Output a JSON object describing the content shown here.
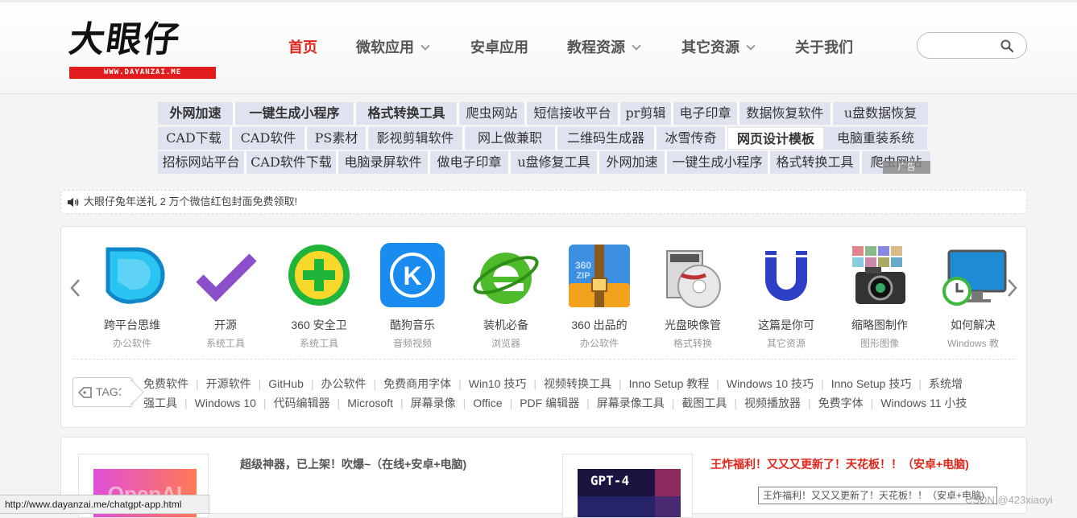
{
  "header": {
    "logo_text": "大眼仔",
    "logo_sub": "WWW.DAYANZAI.ME",
    "nav": [
      {
        "label": "首页",
        "active": true,
        "dropdown": false
      },
      {
        "label": "微软应用",
        "active": false,
        "dropdown": true
      },
      {
        "label": "安卓应用",
        "active": false,
        "dropdown": false
      },
      {
        "label": "教程资源",
        "active": false,
        "dropdown": true
      },
      {
        "label": "其它资源",
        "active": false,
        "dropdown": true
      },
      {
        "label": "关于我们",
        "active": false,
        "dropdown": false
      }
    ],
    "search": {
      "placeholder": "",
      "value": "",
      "icon": "search-icon"
    }
  },
  "keywords": {
    "rows": [
      [
        "外网加速",
        "一键生成小程序",
        "格式转换工具",
        "爬虫网站",
        "短信接收平台",
        "pr剪辑",
        "电子印章",
        "数据恢复软件",
        "u盘数据恢复"
      ],
      [
        "CAD下载",
        "CAD软件",
        "PS素材",
        "影视剪辑软件",
        "网上做兼职",
        "二维码生成器",
        "冰雪传奇",
        "网页设计模板",
        "电脑重装系统"
      ],
      [
        "招标网站平台",
        "CAD软件下载",
        "电脑录屏软件",
        "做电子印章",
        "u盘修复工具",
        "外网加速",
        "一键生成小程序",
        "格式转换工具",
        "爬虫网站"
      ]
    ],
    "ad_label": "广告"
  },
  "notice": {
    "icon": "speaker-icon",
    "text": "大眼仔兔年送礼 2 万个微信红包封面免费领取!"
  },
  "apps": [
    {
      "name": "跨平台思维",
      "category": "办公软件",
      "icon": "xmind-icon"
    },
    {
      "name": "开源",
      "category": "系统工具",
      "icon": "checkmark-icon"
    },
    {
      "name": "360 安全卫",
      "category": "系统工具",
      "icon": "360-security-icon"
    },
    {
      "name": "酷狗音乐",
      "category": "音频视频",
      "icon": "kugou-icon"
    },
    {
      "name": "装机必备",
      "category": "浏览器",
      "icon": "ie-browser-icon"
    },
    {
      "name": "360 出品的",
      "category": "办公软件",
      "icon": "360-zip-icon"
    },
    {
      "name": "光盘映像管",
      "category": "格式转换",
      "icon": "disc-image-icon"
    },
    {
      "name": "这篇是你可",
      "category": "其它资源",
      "icon": "magnet-u-icon"
    },
    {
      "name": "缩略图制作",
      "category": "图形图像",
      "icon": "photo-camera-icon"
    },
    {
      "name": "如何解决",
      "category": "Windows 教",
      "icon": "monitor-clock-icon"
    }
  ],
  "tags": {
    "label": "TAGS",
    "line1": [
      "免费软件",
      "开源软件",
      "GitHub",
      "办公软件",
      "免费商用字体",
      "Win10 技巧",
      "视频转换工具",
      "Inno Setup 教程",
      "Windows 10 技巧",
      "Inno Setup 技巧",
      "系统增"
    ],
    "line2": [
      "强工具",
      "Windows 10",
      "代码编辑器",
      "Microsoft",
      "屏幕录像",
      "Office",
      "PDF 编辑器",
      "屏幕录像工具",
      "截图工具",
      "视频播放器",
      "免费字体",
      "Windows 11 小技"
    ]
  },
  "posts": [
    {
      "title": "超级神器，已上架！吹爆~（在线+安卓+电脑)",
      "thumb_text": "OpenAI",
      "highlight": false
    },
    {
      "title": "王炸福利！又又又更新了！天花板！！（安卓+电脑)",
      "thumb_text": "GPT-4",
      "highlight": true
    }
  ],
  "status_url": "http://www.dayanzai.me/chatgpt-app.html",
  "tooltip": "王炸福利！又又又更新了！天花板！！（安卓+电脑)",
  "watermark": "CSDN @423xiaoyi",
  "colors": {
    "accent": "#e1251b",
    "tag_bg": "#dfe3ef"
  }
}
